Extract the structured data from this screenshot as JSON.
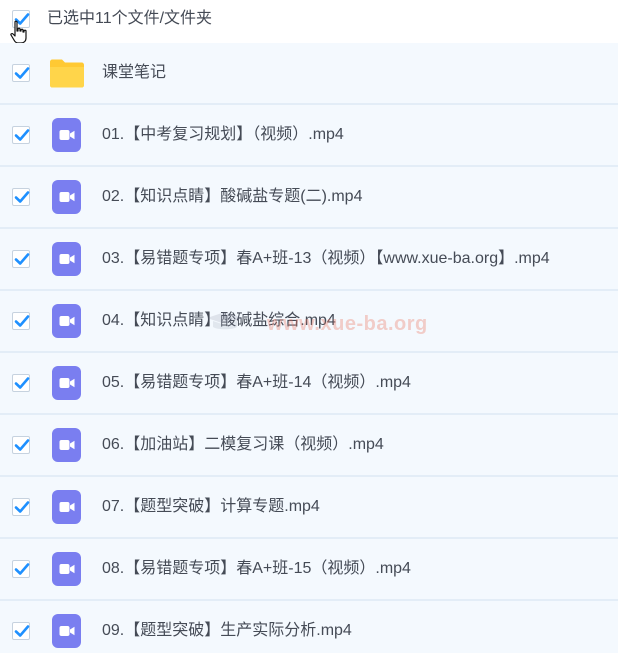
{
  "header": {
    "selection_label": "已选中11个文件/文件夹"
  },
  "items": [
    {
      "type": "folder",
      "name": "课堂笔记"
    },
    {
      "type": "video",
      "name": "01.【中考复习规划】（视频）.mp4"
    },
    {
      "type": "video",
      "name": "02.【知识点睛】酸碱盐专题(二).mp4"
    },
    {
      "type": "video",
      "name": "03.【易错题专项】春A+班-13（视频）【www.xue-ba.org】.mp4"
    },
    {
      "type": "video",
      "name": "04.【知识点睛】酸碱盐综合.mp4"
    },
    {
      "type": "video",
      "name": "05.【易错题专项】春A+班-14（视频）.mp4"
    },
    {
      "type": "video",
      "name": "06.【加油站】二模复习课（视频）.mp4"
    },
    {
      "type": "video",
      "name": "07.【题型突破】计算专题.mp4"
    },
    {
      "type": "video",
      "name": "08.【易错题专项】春A+班-15（视频）.mp4"
    },
    {
      "type": "video",
      "name": "09.【题型突破】生产实际分析.mp4"
    }
  ],
  "watermark": {
    "text": "www.xue-ba.org"
  },
  "colors": {
    "checkbox_tick": "#1e90ff",
    "video_icon": "#7a7ef0",
    "folder_icon": "#ffc933",
    "row_background": "#f4f9fe"
  }
}
